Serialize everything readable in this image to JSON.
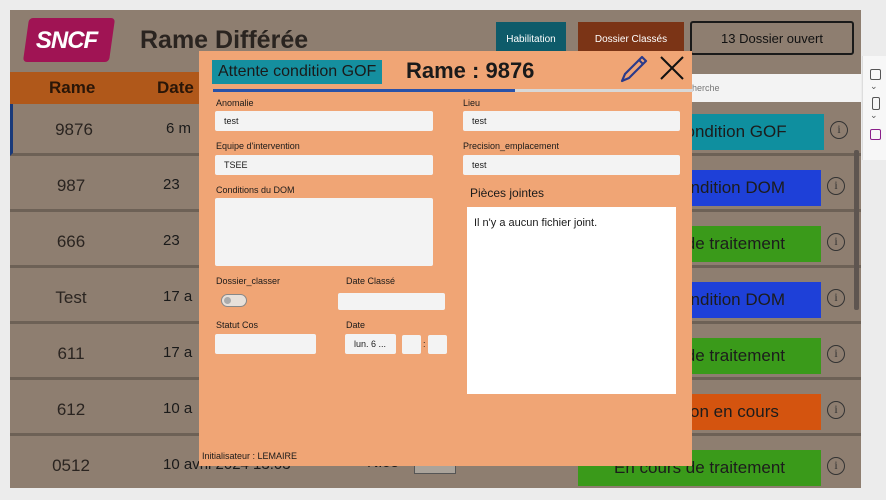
{
  "app": {
    "logo_text": "SNCF",
    "title": "Rame Différée",
    "buttons": {
      "habilitation": "Habilitation",
      "dossier_classes": "Dossier Classés",
      "dossiers_ouverts": "13 Dossier ouvert"
    },
    "columns": {
      "rame": "Rame",
      "date": "Date"
    },
    "search_placeholder": "Recherche"
  },
  "rows": [
    {
      "rame": "9876",
      "date": "6 m",
      "lieu": "",
      "status": "Attente condition GOF",
      "status_color": "#0f8f9f",
      "selected": true,
      "info": "i"
    },
    {
      "rame": "987",
      "date": "23",
      "lieu": "",
      "status": "Attente condition DOM",
      "status_color": "#1e40d8",
      "info": "i"
    },
    {
      "rame": "666",
      "date": "23",
      "lieu": "",
      "status": "En cours de traitement",
      "status_color": "#3a9a1a",
      "info": "i"
    },
    {
      "rame": "Test",
      "date": "17 a",
      "lieu": "",
      "status": "Attente condition DOM",
      "status_color": "#1e40d8",
      "info": "i"
    },
    {
      "rame": "611",
      "date": "17 a",
      "lieu": "",
      "status": "En cours de traitement",
      "status_color": "#3a9a1a",
      "info": "i"
    },
    {
      "rame": "612",
      "date": "10 a",
      "lieu": "",
      "status": "Intervention en cours",
      "status_color": "#d4540f",
      "info": "i"
    },
    {
      "rame": "0512",
      "date": "10 avril 2024 13:03",
      "lieu": "Nice",
      "status": "En cours de traitement",
      "status_color": "#3a9a1a",
      "info": "i"
    }
  ],
  "modal": {
    "status_badge": "Attente condition GOF",
    "title": "Rame : 9876",
    "progress_fraction": 0.63,
    "fields": {
      "anomalie_label": "Anomalie",
      "anomalie_value": "test",
      "lieu_label": "Lieu",
      "lieu_value": "test",
      "equipe_label": "Equipe d'intervention",
      "equipe_value": "TSEE",
      "precision_label": "Precision_emplacement",
      "precision_value": "test",
      "conditions_label": "Conditions du DOM",
      "conditions_value": "",
      "dossier_label": "Dossier_classer",
      "date_classe_label": "Date Classé",
      "date_classe_value": "",
      "statut_label": "Statut Cos",
      "statut_value": "",
      "date_label": "Date",
      "date_value": "lun. 6 ...",
      "hour_value": "",
      "minute_value": "",
      "time_sep": ":"
    },
    "attachments": {
      "title": "Pièces jointes",
      "empty_text": "Il n'y a aucun fichier joint."
    },
    "initiator": "Initialisateur : LEMAIRE"
  }
}
